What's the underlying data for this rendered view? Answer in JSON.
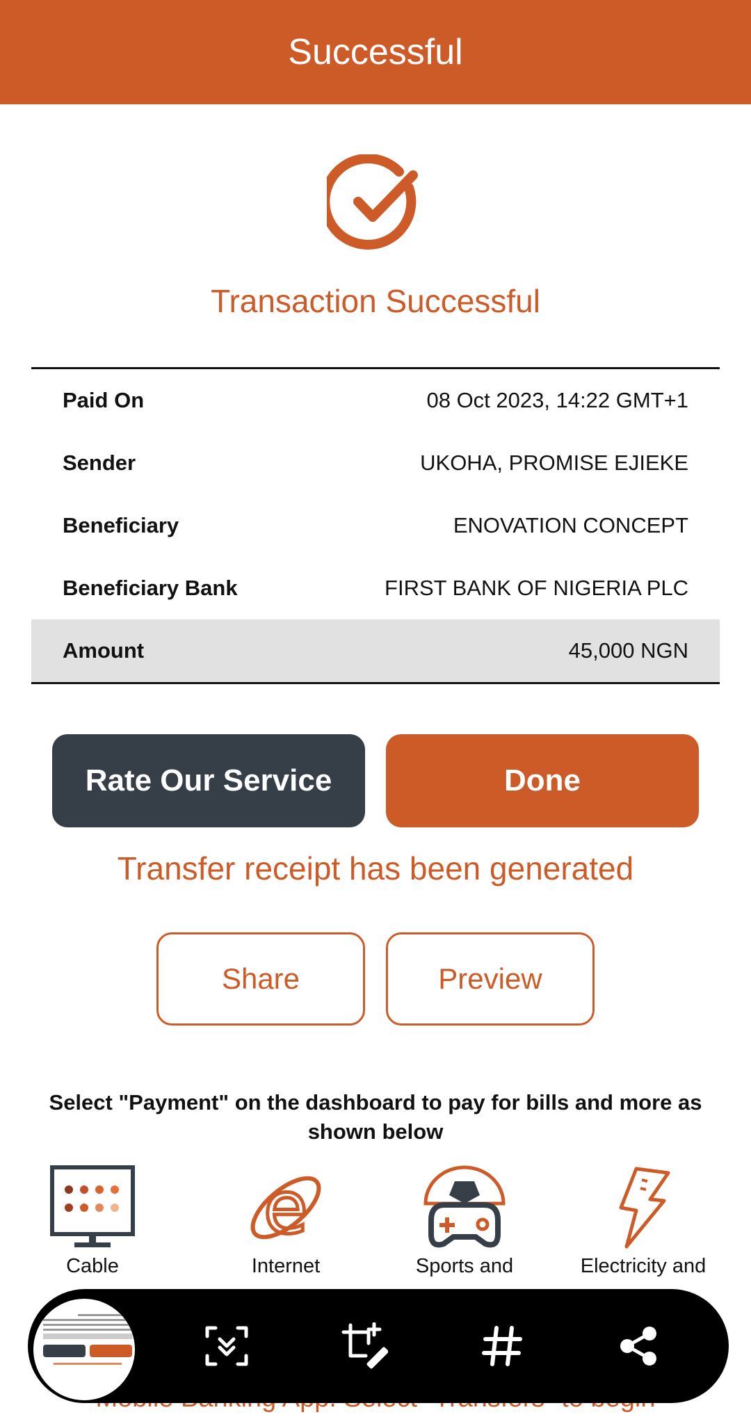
{
  "header": {
    "title": "Successful"
  },
  "status": {
    "title": "Transaction Successful"
  },
  "details": {
    "rows": [
      {
        "label": "Paid On",
        "value": "08 Oct 2023, 14:22 GMT+1"
      },
      {
        "label": "Sender",
        "value": "UKOHA, PROMISE EJIEKE"
      },
      {
        "label": "Beneficiary",
        "value": "ENOVATION CONCEPT"
      },
      {
        "label": "Beneficiary Bank",
        "value": "FIRST BANK OF NIGERIA PLC"
      },
      {
        "label": "Amount",
        "value": "45,000 NGN"
      }
    ]
  },
  "actions": {
    "rate_label": "Rate Our Service",
    "done_label": "Done"
  },
  "receipt": {
    "message": "Transfer receipt has been generated",
    "share_label": "Share",
    "preview_label": "Preview"
  },
  "promo": {
    "text": "Select \"Payment\" on the dashboard to pay for bills and more as shown below",
    "services": [
      {
        "label": "Cable",
        "icon": "tv-icon"
      },
      {
        "label": "Internet",
        "icon": "internet-explorer-icon"
      },
      {
        "label": "Sports and",
        "icon": "sports-gaming-icon"
      },
      {
        "label": "Electricity and",
        "icon": "lightning-icon"
      }
    ],
    "bottom_text": "Mobile Banking App. Select \"Transfers\" to begin"
  },
  "screenshot_toolbar": {
    "icons": [
      "screenshot-thumbnail",
      "scroll-capture-icon",
      "crop-edit-icon",
      "hashtag-icon",
      "share-icon"
    ]
  },
  "colors": {
    "accent": "#cd5b28",
    "dark": "#363e48",
    "amount_bg": "#e1e1e1"
  }
}
